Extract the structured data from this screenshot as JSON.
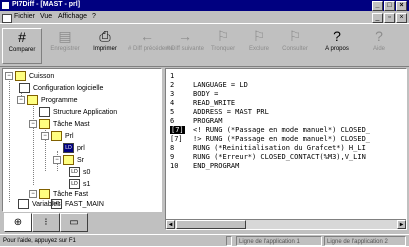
{
  "window": {
    "title": "PI7Diff - [MAST - prl]"
  },
  "menu": {
    "items": [
      "Fichier",
      "Vue",
      "Affichage",
      "?"
    ]
  },
  "toolbar": {
    "buttons": [
      {
        "label": "Comparer",
        "icon": "#",
        "enabled": true
      },
      {
        "label": "Enregistrer",
        "icon": "▤",
        "enabled": false
      },
      {
        "label": "Imprimer",
        "icon": "⎙",
        "enabled": true
      },
      {
        "label": "# Diff précédente",
        "icon": "←",
        "enabled": false
      },
      {
        "label": "# Diff suivante",
        "icon": "→",
        "enabled": false
      },
      {
        "label": "Tronquer",
        "icon": "⚐",
        "enabled": false
      },
      {
        "label": "Exclure",
        "icon": "⚐",
        "enabled": false
      },
      {
        "label": "Consulter",
        "icon": "⚐",
        "enabled": false
      },
      {
        "label": "A propos",
        "icon": "?",
        "enabled": true
      },
      {
        "label": "Aide",
        "icon": "?",
        "enabled": false
      }
    ]
  },
  "tree": {
    "nodes": [
      {
        "label": "Cuisson"
      },
      {
        "label": "Configuration logicielle"
      },
      {
        "label": "Programme"
      },
      {
        "label": "Structure Application"
      },
      {
        "label": "Tâche Mast"
      },
      {
        "label": "Prl"
      },
      {
        "label": "prl"
      },
      {
        "label": "Sr"
      },
      {
        "label": "s0"
      },
      {
        "label": "s1"
      },
      {
        "label": "Tâche Fast"
      },
      {
        "label": "FAST_MAIN"
      },
      {
        "label": "Variables"
      }
    ]
  },
  "editor": {
    "lines": [
      {
        "num": "1",
        "text": ""
      },
      {
        "num": "2",
        "text": "LANGUAGE = LD"
      },
      {
        "num": "3",
        "text": "BODY ="
      },
      {
        "num": "4",
        "text": "READ_WRITE"
      },
      {
        "num": "5",
        "text": "ADDRESS = MAST PRL"
      },
      {
        "num": "6",
        "text": "PROGRAM"
      },
      {
        "num": "[7]",
        "text": "<! RUNG (*Passage en mode manuel*) CLOSED_",
        "highlight": true
      },
      {
        "num": "[7]",
        "text": "!> RUNG (*Passage en mode manuel*) CLOSED_"
      },
      {
        "num": "8",
        "text": "RUNG (*Reinitialisation du Grafcet*) H_LI"
      },
      {
        "num": "9",
        "text": "RUNG (*Erreur*) CLOSED_CONTACT(%M3),V_LIN"
      },
      {
        "num": "10",
        "text": "END_PROGRAM"
      }
    ]
  },
  "status": {
    "help": "Pour l'aide, appuyez sur F1",
    "panel1": "Ligne de l'application 1",
    "panel2": "Ligne de l'application 2"
  }
}
